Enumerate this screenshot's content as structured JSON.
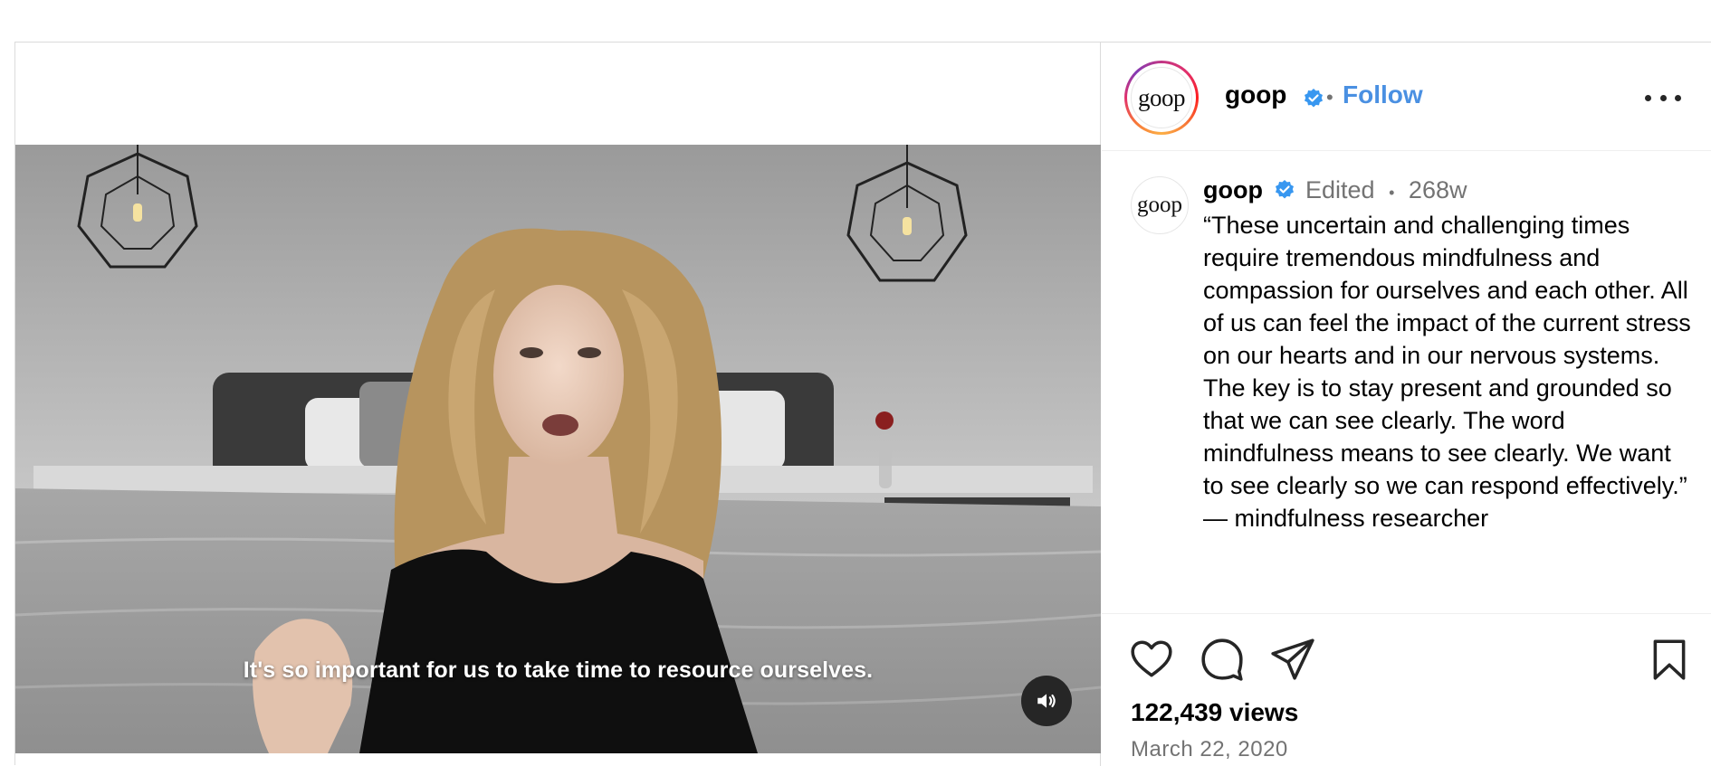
{
  "post": {
    "username": "goop",
    "logo_text": "goop",
    "follow_label": "Follow",
    "separator": "•",
    "video": {
      "caption": "It's so important for us to take time to resource ourselves."
    },
    "comment": {
      "username": "goop",
      "edited_label": "Edited",
      "separator": "•",
      "time_ago": "268w",
      "text": "“These uncertain and challenging times require tremendous mindfulness and compassion for ourselves and each other. All of us can feel the impact of the current stress on our hearts and in our nervous systems. The key is to stay present and grounded so that we can see clearly. The word mindfulness means to see clearly. We want to see clearly so we can respond effectively.” — mindfulness researcher"
    },
    "views_label": "122,439 views",
    "date_label": "March 22, 2020"
  },
  "icons": {
    "verified": "verified-badge-icon",
    "more": "more-options-icon",
    "like": "heart-icon",
    "comment": "comment-bubble-icon",
    "share": "paper-plane-icon",
    "save": "bookmark-icon",
    "mute": "speaker-icon"
  },
  "colors": {
    "accent": "#4a90e2",
    "verified": "#3897f0",
    "muted_text": "#737373",
    "border": "#dbdbdb"
  }
}
